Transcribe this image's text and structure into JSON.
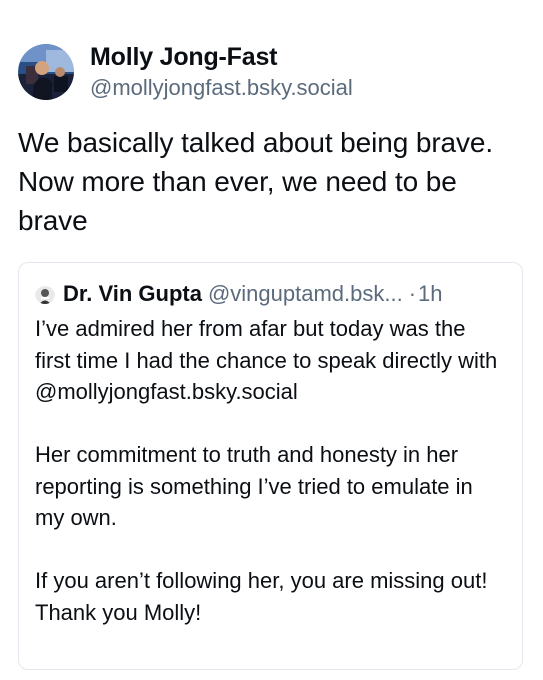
{
  "post": {
    "author": {
      "display_name": "Molly Jong-Fast",
      "handle": "@mollyjongfast.bsky.social",
      "avatar_icon": "user-avatar-photo"
    },
    "text": "We basically talked about being brave. Now more than ever, we need to be brave"
  },
  "quote": {
    "author": {
      "display_name": "Dr. Vin Gupta",
      "handle": "@vinguptamd.bsk...",
      "avatar_icon": "user-avatar-photo"
    },
    "separator": "·",
    "time": "1h",
    "paragraphs": [
      "I’ve admired her from afar but today was the first time I had the chance to speak directly with @mollyjongfast.bsky.social",
      "Her commitment to truth and honesty in her reporting is something I’ve tried to emulate in my own.",
      "If you aren’t following her, you are missing out! Thank you Molly!"
    ]
  },
  "colors": {
    "text_primary": "#0b0f14",
    "text_secondary": "#5b6b7c",
    "card_border": "#e3e8ee",
    "background": "#ffffff"
  }
}
